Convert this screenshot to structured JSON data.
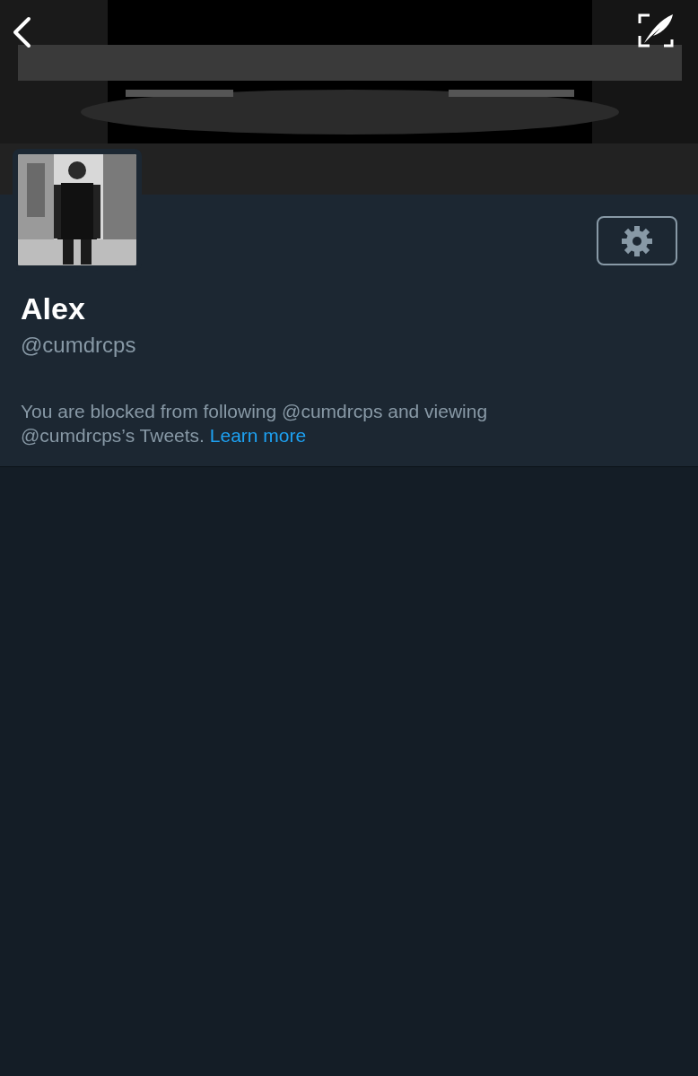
{
  "profile": {
    "name": "Alex",
    "handle": "@cumdrcps",
    "notice": {
      "text": "You are blocked from following @cumdrcps and viewing @cumdrcps’s Tweets.",
      "link": "Learn more"
    }
  }
}
